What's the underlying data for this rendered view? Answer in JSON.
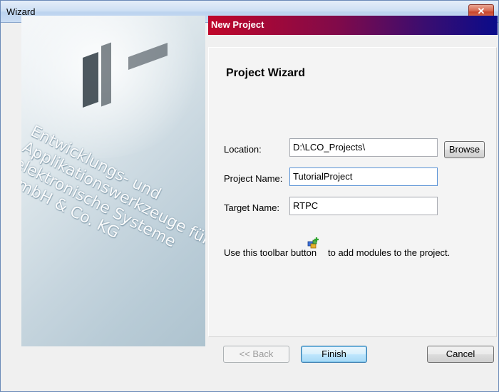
{
  "window": {
    "title": "Wizard",
    "close_symbol": "✕"
  },
  "side_image": {
    "text": "Entwicklungs- und\nApplikationswerkzeuge für\nelektronische Systeme\nGmbH & Co. KG"
  },
  "header": {
    "title": "New Project"
  },
  "panel": {
    "title": "Project Wizard",
    "location_label": "Location:",
    "location_value": "D:\\LCO_Projects\\",
    "browse_label": "Browse",
    "project_name_label": "Project Name:",
    "project_name_value": "TutorialProject",
    "target_name_label": "Target Name:",
    "target_name_value": "RTPC",
    "hint_before": "Use this toolbar button",
    "hint_after": "to add modules to the project.",
    "hint_icon": "add-module-icon"
  },
  "buttons": {
    "back": "<< Back",
    "finish": "Finish",
    "cancel": "Cancel"
  }
}
